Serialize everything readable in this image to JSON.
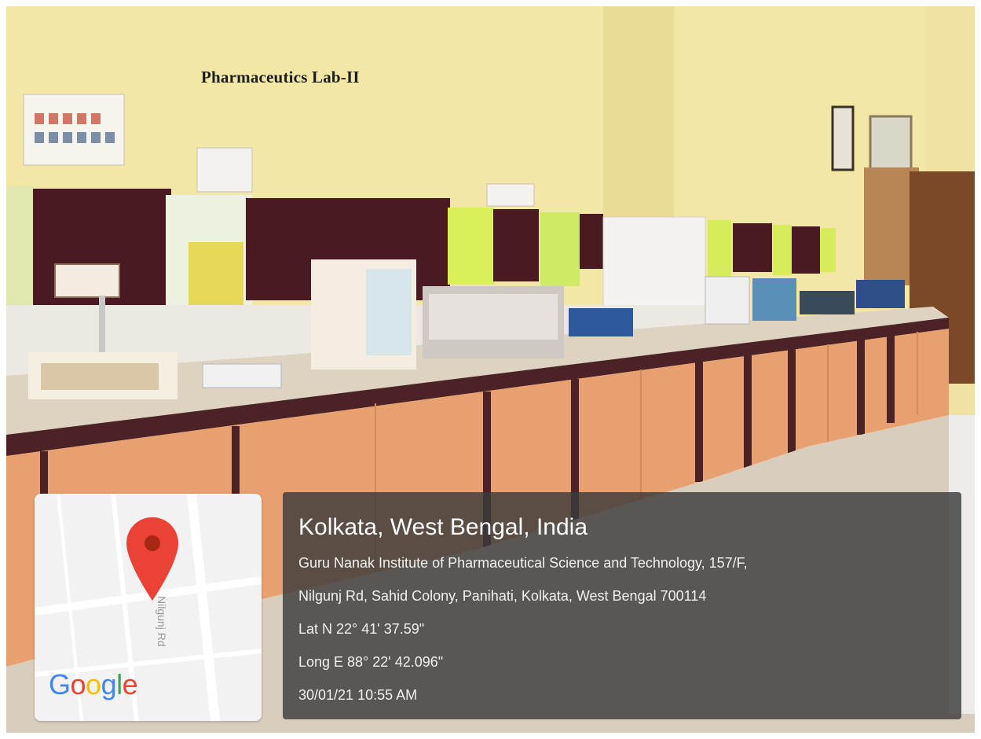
{
  "wall_sign": {
    "text": "Pharmaceutics Lab-II"
  },
  "map_card": {
    "road_label": "Nilgunj Rd",
    "logo_letters": [
      "G",
      "o",
      "o",
      "g",
      "l",
      "e"
    ],
    "pin_color": "#ea4335"
  },
  "location": {
    "title": "Kolkata, West Bengal, India",
    "address_line1": "Guru Nanak Institute of Pharmaceutical Science and Technology, 157/F,",
    "address_line2": "Nilgunj Rd, Sahid Colony, Panihati, Kolkata, West Bengal 700114",
    "latitude": "Lat N 22° 41' 37.59\"",
    "longitude": "Long E 88° 22' 42.096\"",
    "timestamp": "30/01/21 10:55 AM"
  },
  "colors": {
    "wall": "#f3e7a6",
    "board": "#4a1a22",
    "cabinet": "#e9a070",
    "countertop": "#ddd3c0",
    "overlay": "#38383a"
  }
}
